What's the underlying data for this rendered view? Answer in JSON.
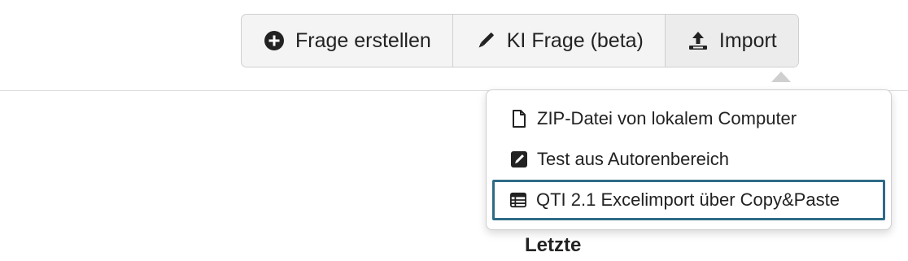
{
  "toolbar": {
    "create_label": "Frage erstellen",
    "ai_label": "KI Frage (beta)",
    "import_label": "Import"
  },
  "import_menu": {
    "items": [
      {
        "label": "ZIP-Datei von lokalem Computer",
        "icon": "file-icon"
      },
      {
        "label": "Test aus Autorenbereich",
        "icon": "edit-square-icon"
      },
      {
        "label": "QTI 2.1 Excelimport über Copy&Paste",
        "icon": "table-icon",
        "highlighted": true
      }
    ]
  },
  "section": {
    "heading": "Letzte"
  },
  "colors": {
    "highlight_border": "#2d6b86",
    "button_bg": "#f4f4f4"
  }
}
